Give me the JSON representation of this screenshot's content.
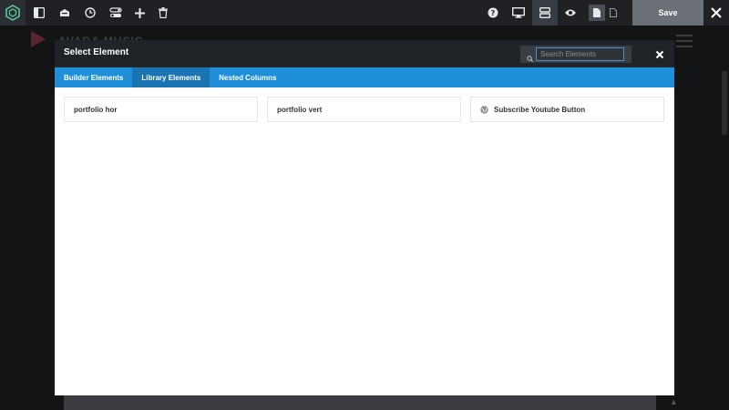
{
  "toolbar": {
    "save_label": "Save",
    "icons": [
      "builder-logo-icon",
      "sidebar-icon",
      "library-icon",
      "history-icon",
      "toggles-icon",
      "add-icon",
      "trash-icon",
      "help-icon",
      "desktop-icon",
      "layout-icon",
      "preview-icon",
      "page-icon",
      "page-outline-icon",
      "close-icon"
    ]
  },
  "background_site": {
    "brand_title": "AVADA MUSIC"
  },
  "modal": {
    "title": "Select Element",
    "search": {
      "placeholder": "Search Elements",
      "value": ""
    },
    "tabs": [
      {
        "label": "Builder Elements",
        "active": false
      },
      {
        "label": "Library Elements",
        "active": true
      },
      {
        "label": "Nested Columns",
        "active": false
      }
    ],
    "elements": [
      {
        "label": "portfolio hor",
        "icon": ""
      },
      {
        "label": "portfolio vert",
        "icon": ""
      },
      {
        "label": "Subscribe Youtube Button",
        "icon": "globe-icon"
      }
    ]
  },
  "colors": {
    "toolbar_bg": "#1f2125",
    "modal_header": "#202327",
    "tab_bar": "#1e8fd8",
    "tab_active": "#1a74b2",
    "save_button": "#6b6f76"
  }
}
